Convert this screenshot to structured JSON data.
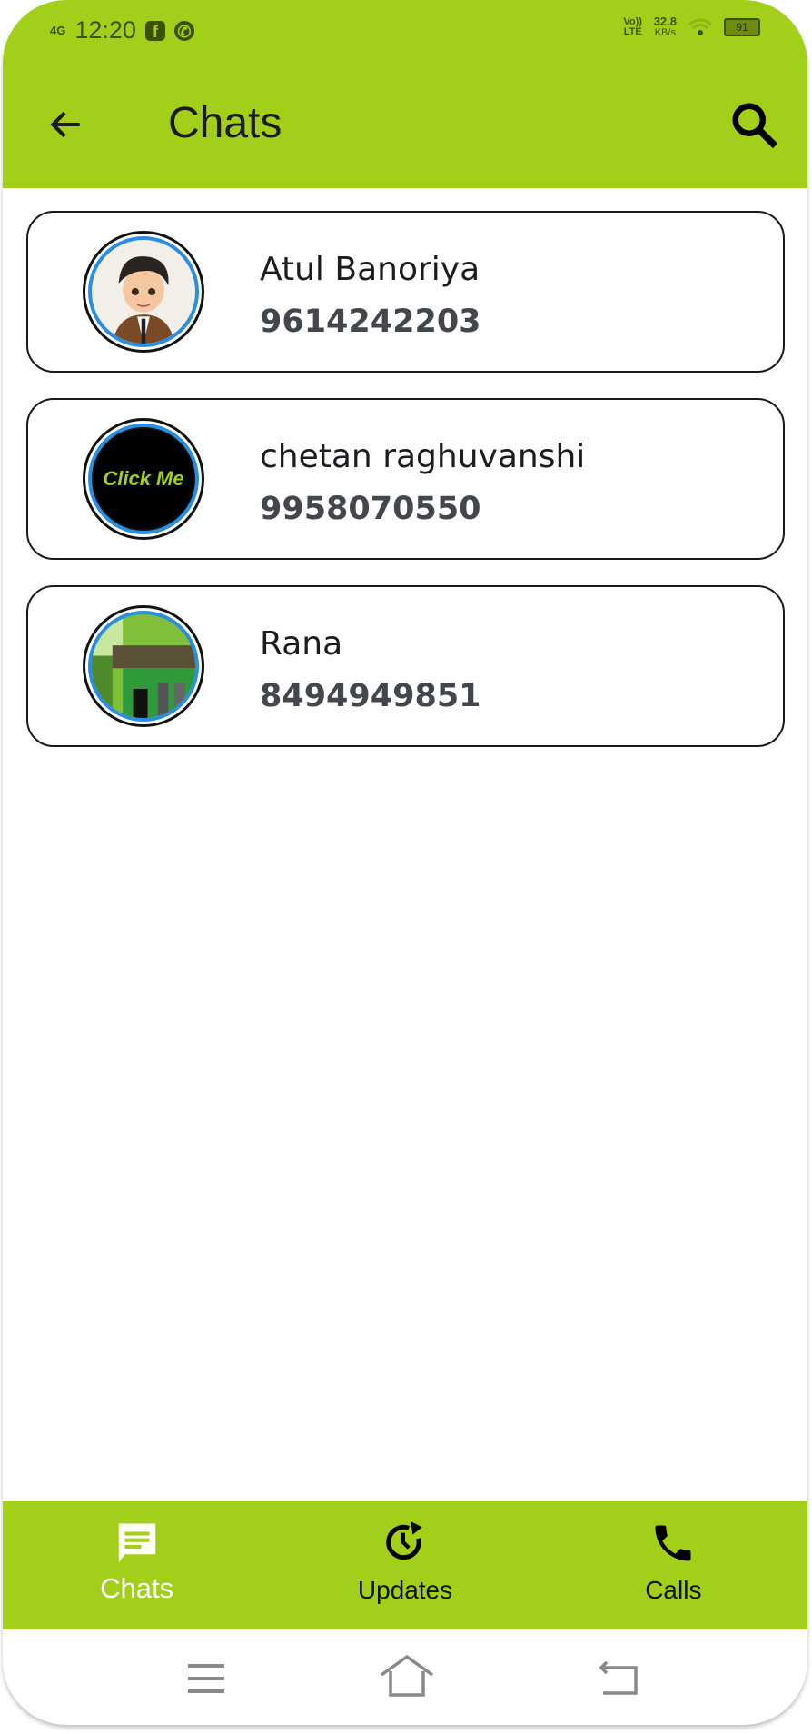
{
  "colors": {
    "brand": "#a2d01a",
    "ring": "#2a8ee0",
    "active_nav": "#ffffff"
  },
  "status_bar": {
    "network": "4G",
    "time": "12:20",
    "volte": "Vo)) LTE",
    "speed_value": "32.8",
    "speed_unit": "KB/s",
    "battery": "91"
  },
  "header": {
    "title": "Chats",
    "back_icon": "arrow-left-icon",
    "search_icon": "search-icon"
  },
  "chats": [
    {
      "name": "Atul Banoriya",
      "phone": "9614242203",
      "avatar": "cartoon-boy"
    },
    {
      "name": "chetan raghuvanshi",
      "phone": "9958070550",
      "avatar": "click-me-logo",
      "avatar_text": "Click Me"
    },
    {
      "name": "Rana",
      "phone": "8494949851",
      "avatar": "pixel-house"
    }
  ],
  "bottom_nav": [
    {
      "label": "Chats",
      "icon": "chat-icon",
      "active": true
    },
    {
      "label": "Updates",
      "icon": "updates-icon",
      "active": false
    },
    {
      "label": "Calls",
      "icon": "phone-icon",
      "active": false
    }
  ]
}
